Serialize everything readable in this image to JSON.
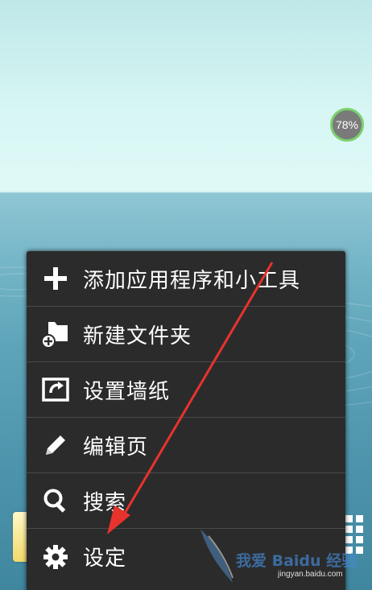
{
  "status": {
    "badge_text": "78%"
  },
  "menu": {
    "items": [
      {
        "label": "添加应用程序和小工具",
        "icon": "plus-icon"
      },
      {
        "label": "新建文件夹",
        "icon": "new-folder-icon"
      },
      {
        "label": "设置墙纸",
        "icon": "wallpaper-icon"
      },
      {
        "label": "编辑页",
        "icon": "edit-pencil-icon"
      },
      {
        "label": "搜索",
        "icon": "search-icon"
      },
      {
        "label": "设定",
        "icon": "gear-icon"
      }
    ]
  },
  "watermark": {
    "line1": "我爱 Baidu 经验",
    "line2": "jingyan.baidu.com"
  },
  "colors": {
    "menu_bg": "#2b2b2b",
    "arrow": "#e8332d",
    "badge_ring": "#7bd06d"
  }
}
